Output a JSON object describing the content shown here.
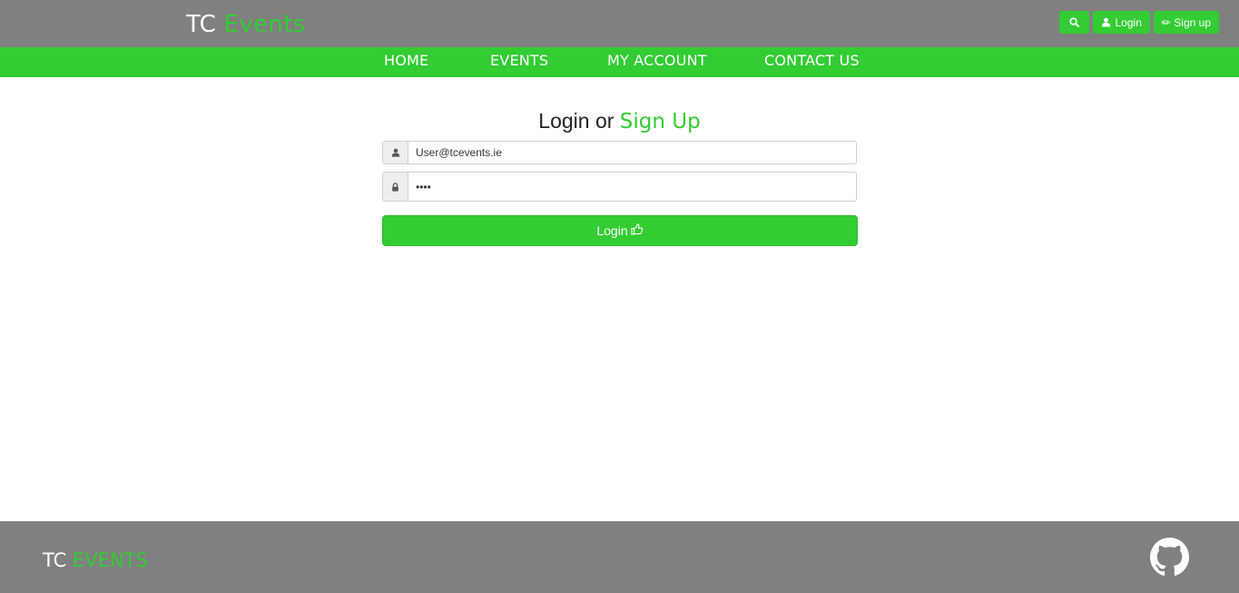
{
  "header": {
    "brand_prefix": "TC",
    "brand_accent": "Events",
    "actions": {
      "search_icon": "search-icon",
      "login_label": "Login",
      "signup_label": "✏ Sign up"
    }
  },
  "nav": {
    "items": [
      "HOME",
      "EVENTS",
      "MY ACCOUNT",
      "CONTACT US"
    ]
  },
  "login": {
    "title_prefix": "Login or",
    "title_accent": "Sign Up",
    "email_value": "User@tcevents.ie",
    "password_value": "••••",
    "submit_label": "Login"
  },
  "footer": {
    "brand_prefix": "TC",
    "brand_accent": "EVENTS",
    "github_icon": "github-icon"
  },
  "colors": {
    "accent": "#33cc33",
    "bar_gray": "#808080",
    "white": "#ffffff"
  }
}
